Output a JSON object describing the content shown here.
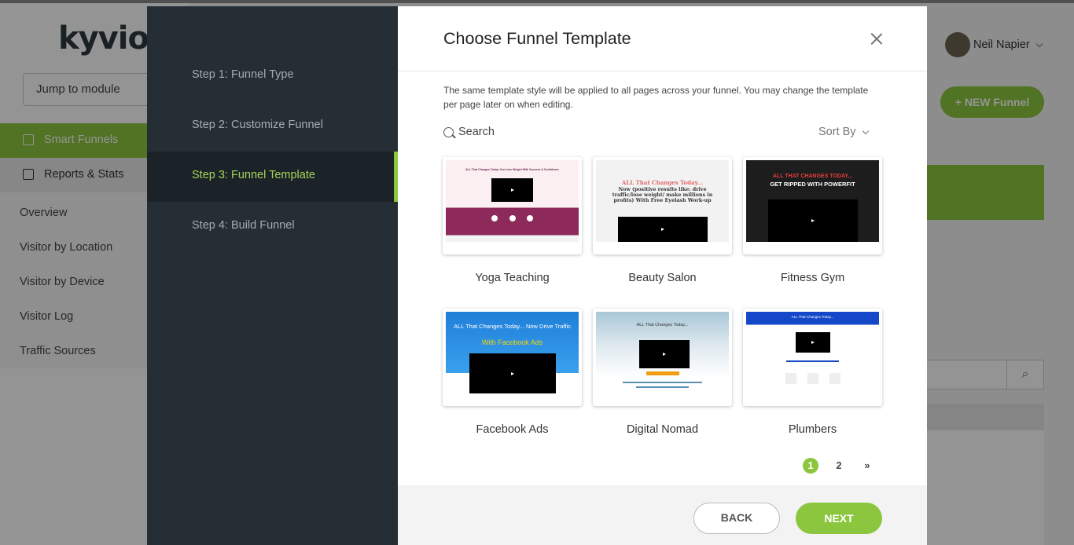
{
  "app": {
    "logo": "kyvio",
    "jump_label": "Jump to module",
    "nav": [
      {
        "label": "Smart Funnels"
      },
      {
        "label": "Reports & Stats"
      }
    ],
    "sub_nav": [
      "Overview",
      "Visitor by Location",
      "Visitor by Device",
      "Visitor Log",
      "Traffic Sources"
    ],
    "user_name": "Neil Napier",
    "new_funnel_label": "+ NEW Funnel"
  },
  "modal": {
    "steps": [
      "Step 1: Funnel Type",
      "Step 2: Customize Funnel",
      "Step 3: Funnel Template",
      "Step 4: Build Funnel"
    ],
    "active_step": 2,
    "title": "Choose Funnel Template",
    "description": "The same template style will be applied to all pages across your funnel. You may change the template per page later on when editing.",
    "search_label": "Search",
    "sort_label": "Sort By",
    "templates": [
      {
        "name": "Yoga Teaching",
        "thumb_headline": "ALL That Changes Today, You Lose Weight With Success & Confidence"
      },
      {
        "name": "Beauty Salon",
        "thumb_headline": "ALL That Changes Today...",
        "thumb_sub": "Now (positive results like: drive traffic/lose weight/ make millions in profits) With Free Eyelash Work-up"
      },
      {
        "name": "Fitness Gym",
        "thumb_headline": "ALL THAT CHANGES TODAY...",
        "thumb_sub": "GET RIPPED WITH POWERFIT"
      },
      {
        "name": "Facebook Ads",
        "thumb_headline": "ALL That Changes Today... Now Drive Traffic",
        "thumb_sub": "With Facebook Ads"
      },
      {
        "name": "Digital Nomad",
        "thumb_headline": "ALL That Changes Today..."
      },
      {
        "name": "Plumbers",
        "thumb_headline": "ALL That Changes Today..."
      }
    ],
    "pagination": [
      "1",
      "2",
      "»"
    ],
    "current_page": "1",
    "back_label": "BACK",
    "next_label": "NEXT"
  },
  "colors": {
    "accent": "#8cc63f",
    "steps_bg": "#252d35",
    "active_step_bg": "#1b2228"
  }
}
